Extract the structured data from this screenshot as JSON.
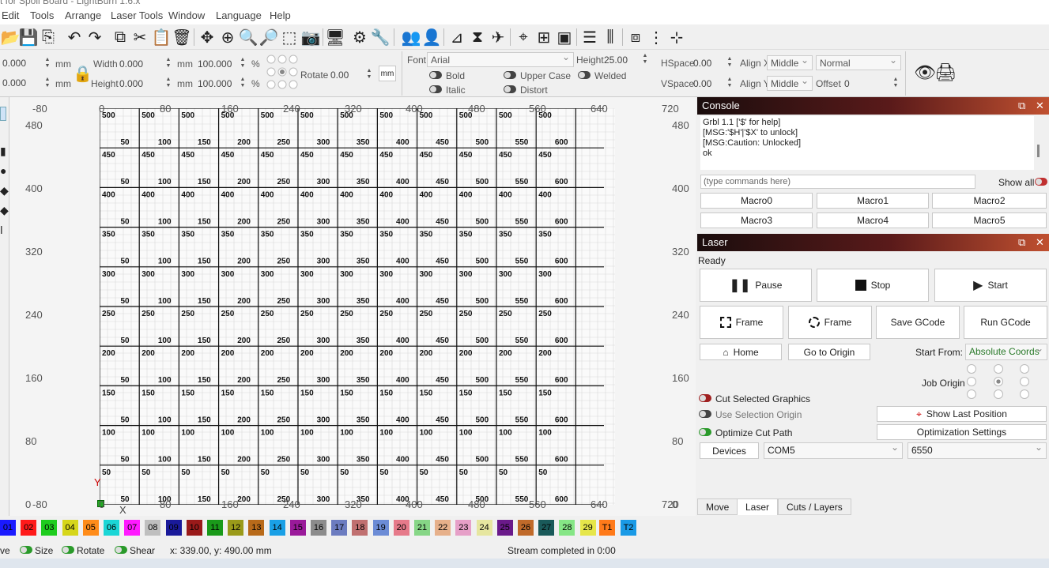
{
  "title": "t for Spoil Board - LightBurn 1.6.x",
  "menu": [
    "Edit",
    "Tools",
    "Arrange",
    "Laser Tools",
    "Window",
    "Language",
    "Help"
  ],
  "toolbar_icons": [
    "open-icon",
    "save-icon",
    "import-icon",
    "undo-icon",
    "redo-icon",
    "copy-icon",
    "cut-icon",
    "paste-icon",
    "delete-icon",
    "move-icon",
    "zoom-fit-icon",
    "zoom-in-icon",
    "zoom-out-icon",
    "select-frame-icon",
    "camera-icon",
    "monitor-icon",
    "settings-icon",
    "tools-icon",
    "group-icon",
    "user-icon",
    "flip-h-icon",
    "mirror-icon",
    "send-icon",
    "target-icon",
    "align-icon",
    "distribute-icon",
    "align-v-icon",
    "distribute-v-icon",
    "arrange-icon",
    "space-icon"
  ],
  "props": {
    "x_value": "0.000",
    "y_value": "0.000",
    "unit": "mm",
    "width_label": "Width",
    "width_value": "0.000",
    "height_label": "Height",
    "height_value": "0.000",
    "scale_w": "100.000",
    "scale_h": "100.000",
    "percent": "%",
    "rotate_label": "Rotate",
    "rotate_value": "0.00",
    "rotate_unit": "mm",
    "font_label": "Font",
    "font_value": "Arial",
    "font_height_label": "Height",
    "font_height_value": "25.00",
    "bold": "Bold",
    "italic": "Italic",
    "upper_case": "Upper Case",
    "welded": "Welded",
    "distort": "Distort",
    "hspace_label": "HSpace",
    "hspace_value": "0.00",
    "vspace_label": "VSpace",
    "vspace_value": "0.00",
    "align_x_label": "Align X",
    "align_x_value": "Middle",
    "align_y_label": "Align Y",
    "align_y_value": "Middle",
    "normal_value": "Normal",
    "offset_label": "Offset",
    "offset_value": "0"
  },
  "rulers": {
    "top": [
      "-80",
      "0",
      "80",
      "160",
      "240",
      "320",
      "400",
      "480",
      "560",
      "640",
      "720"
    ],
    "left": [
      "480",
      "400",
      "320",
      "240",
      "160",
      "80",
      "0"
    ],
    "right": [
      "480",
      "400",
      "320",
      "240",
      "160",
      "80",
      "0"
    ],
    "bottom": [
      "-80",
      "0",
      "80",
      "160",
      "240",
      "320",
      "400",
      "480",
      "560",
      "640",
      "720"
    ]
  },
  "axis_y": "Y",
  "axis_x": "X",
  "grid": {
    "rows": [
      {
        "top": "500",
        "right": "50"
      },
      {
        "top": "450",
        "right": "50"
      },
      {
        "top": "400",
        "right": "50"
      },
      {
        "top": "350",
        "right": "50"
      },
      {
        "top": "300",
        "right": "50"
      },
      {
        "top": "250",
        "right": "50"
      },
      {
        "top": "200",
        "right": "50"
      },
      {
        "top": "150",
        "right": "50"
      },
      {
        "top": "100",
        "right": "50"
      },
      {
        "top": "50",
        "right": "50"
      }
    ],
    "columns": [
      "50",
      "100",
      "150",
      "200",
      "250",
      "300",
      "350",
      "400",
      "450",
      "500",
      "550",
      "600"
    ]
  },
  "console": {
    "title": "Console",
    "lines": [
      "Grbl 1.1 ['$' for help]",
      "[MSG:'$H'|'$X' to unlock]",
      "[MSG:Caution: Unlocked]",
      "ok"
    ],
    "input_placeholder": "(type commands here)",
    "show_all": "Show all",
    "macros": [
      "Macro0",
      "Macro1",
      "Macro2",
      "Macro3",
      "Macro4",
      "Macro5"
    ]
  },
  "laser": {
    "title": "Laser",
    "status": "Ready",
    "pause": "Pause",
    "stop": "Stop",
    "start": "Start",
    "frame1": "Frame",
    "frame2": "Frame",
    "save_gcode": "Save GCode",
    "run_gcode": "Run GCode",
    "home": "Home",
    "go_to_origin": "Go to Origin",
    "start_from_label": "Start From:",
    "start_from_value": "Absolute Coords",
    "job_origin": "Job Origin",
    "cut_selected": "Cut Selected Graphics",
    "use_selection_origin": "Use Selection Origin",
    "optimize_cut_path": "Optimize Cut Path",
    "show_last_position": "Show Last Position",
    "optimization_settings": "Optimization Settings",
    "devices": "Devices",
    "port": "COM5",
    "device": "6550"
  },
  "tabs": [
    "Move",
    "Laser",
    "Cuts / Layers"
  ],
  "palette": [
    {
      "label": "01",
      "color": "#1a1aff"
    },
    {
      "label": "02",
      "color": "#ff1a1a"
    },
    {
      "label": "03",
      "color": "#1ecc1e"
    },
    {
      "label": "04",
      "color": "#d6d61a"
    },
    {
      "label": "05",
      "color": "#ff8c1a"
    },
    {
      "label": "06",
      "color": "#1ad6d6"
    },
    {
      "label": "07",
      "color": "#ff1aff"
    },
    {
      "label": "08",
      "color": "#bfbfbf"
    },
    {
      "label": "09",
      "color": "#1a1a9a"
    },
    {
      "label": "10",
      "color": "#9a1a1a"
    },
    {
      "label": "11",
      "color": "#1a9a1a"
    },
    {
      "label": "12",
      "color": "#9a9a1a"
    },
    {
      "label": "13",
      "color": "#b86a1a"
    },
    {
      "label": "14",
      "color": "#1aa0e6"
    },
    {
      "label": "15",
      "color": "#9a1a9a"
    },
    {
      "label": "16",
      "color": "#8c8c8c"
    },
    {
      "label": "17",
      "color": "#6c7cc0"
    },
    {
      "label": "18",
      "color": "#c07070"
    },
    {
      "label": "19",
      "color": "#6c8cd6"
    },
    {
      "label": "20",
      "color": "#e67a8a"
    },
    {
      "label": "21",
      "color": "#86d686"
    },
    {
      "label": "22",
      "color": "#e6b08a"
    },
    {
      "label": "23",
      "color": "#e6a0c8"
    },
    {
      "label": "24",
      "color": "#e6e6a0"
    },
    {
      "label": "25",
      "color": "#6a1a8a"
    },
    {
      "label": "26",
      "color": "#c06a2a"
    },
    {
      "label": "27",
      "color": "#1a5a5a"
    },
    {
      "label": "28",
      "color": "#86e686"
    },
    {
      "label": "29",
      "color": "#e6e64a"
    },
    {
      "label": "T1",
      "color": "#ff7a1a"
    },
    {
      "label": "T2",
      "color": "#1a9ae6"
    }
  ],
  "status": {
    "move": "ve",
    "size": "Size",
    "rotate": "Rotate",
    "shear": "Shear",
    "coords": "x: 339.00, y: 490.00 mm",
    "stream": "Stream completed in 0:00"
  }
}
